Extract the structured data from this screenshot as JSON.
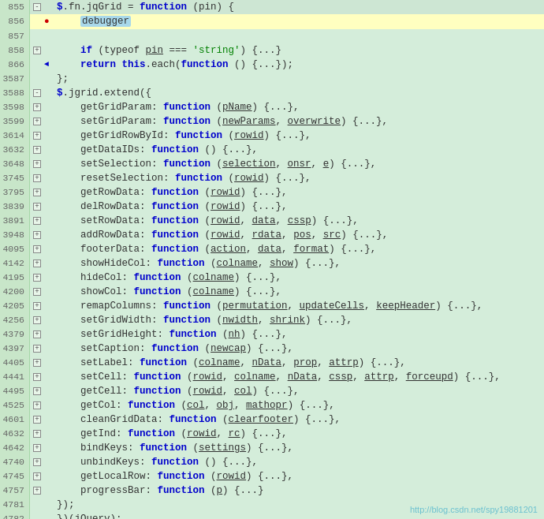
{
  "watermark": "http://blog.csdn.net/spy19881201",
  "lines": [
    {
      "num": "855",
      "indent": 0,
      "fold": "-",
      "arrow": "",
      "breakpoint": false,
      "content": "<span class='kw'>$</span>.fn.jqGrid = <span class='kw'>function</span> (pin) {",
      "highlight": false
    },
    {
      "num": "856",
      "indent": 1,
      "fold": "",
      "arrow": "●",
      "breakpoint": true,
      "content": "<span class='debugger-highlight'>debugger</span>",
      "highlight": true
    },
    {
      "num": "857",
      "indent": 0,
      "fold": "",
      "arrow": "",
      "breakpoint": false,
      "content": "",
      "highlight": false
    },
    {
      "num": "858",
      "indent": 1,
      "fold": "+",
      "arrow": "",
      "breakpoint": false,
      "content": "<span class='kw'>if</span> (typeof <span class='param'>pin</span> === <span class='string'>'string'</span>) {...}",
      "highlight": false
    },
    {
      "num": "866",
      "indent": 1,
      "fold": "",
      "arrow": "◄",
      "breakpoint": false,
      "content": "<span class='kw'>return</span> <span class='kw'>this</span>.each(<span class='kw'>function</span> () {...});",
      "highlight": false
    },
    {
      "num": "3587",
      "indent": 0,
      "fold": "",
      "arrow": "",
      "breakpoint": false,
      "content": "};",
      "highlight": false
    },
    {
      "num": "3588",
      "indent": 0,
      "fold": "-",
      "arrow": "",
      "breakpoint": false,
      "content": "<span class='kw'>$</span>.jgrid.extend({",
      "highlight": false
    },
    {
      "num": "3598",
      "indent": 1,
      "fold": "+",
      "arrow": "",
      "breakpoint": false,
      "content": "getGridParam: <span class='kw'>function</span> (<span class='param'>pName</span>) {...},",
      "highlight": false
    },
    {
      "num": "3599",
      "indent": 1,
      "fold": "+",
      "arrow": "",
      "breakpoint": false,
      "content": "setGridParam: <span class='kw'>function</span> (<span class='param'>newParams</span>, <span class='param'>overwrite</span>) {...},",
      "highlight": false
    },
    {
      "num": "3614",
      "indent": 1,
      "fold": "+",
      "arrow": "",
      "breakpoint": false,
      "content": "getGridRowById: <span class='kw'>function</span> (<span class='param'>rowid</span>) {...},",
      "highlight": false
    },
    {
      "num": "3632",
      "indent": 1,
      "fold": "+",
      "arrow": "",
      "breakpoint": false,
      "content": "getDataIDs: <span class='kw'>function</span> () {...},",
      "highlight": false
    },
    {
      "num": "3648",
      "indent": 1,
      "fold": "+",
      "arrow": "",
      "breakpoint": false,
      "content": "setSelection: <span class='kw'>function</span> (<span class='param'>selection</span>, <span class='param'>onsr</span>, <span class='param'>e</span>) {...},",
      "highlight": false
    },
    {
      "num": "3745",
      "indent": 1,
      "fold": "+",
      "arrow": "",
      "breakpoint": false,
      "content": "resetSelection: <span class='kw'>function</span> (<span class='param'>rowid</span>) {...},",
      "highlight": false
    },
    {
      "num": "3795",
      "indent": 1,
      "fold": "+",
      "arrow": "",
      "breakpoint": false,
      "content": "getRowData: <span class='kw'>function</span> (<span class='param'>rowid</span>) {...},",
      "highlight": false
    },
    {
      "num": "3839",
      "indent": 1,
      "fold": "+",
      "arrow": "",
      "breakpoint": false,
      "content": "delRowData: <span class='kw'>function</span> (<span class='param'>rowid</span>) {...},",
      "highlight": false
    },
    {
      "num": "3891",
      "indent": 1,
      "fold": "+",
      "arrow": "",
      "breakpoint": false,
      "content": "setRowData: <span class='kw'>function</span> (<span class='param'>rowid</span>, <span class='param'>data</span>, <span class='param'>cssp</span>) {...},",
      "highlight": false
    },
    {
      "num": "3948",
      "indent": 1,
      "fold": "+",
      "arrow": "",
      "breakpoint": false,
      "content": "addRowData: <span class='kw'>function</span> (<span class='param'>rowid</span>, <span class='param'>rdata</span>, <span class='param'>pos</span>, <span class='param'>src</span>) {...},",
      "highlight": false
    },
    {
      "num": "4095",
      "indent": 1,
      "fold": "+",
      "arrow": "",
      "breakpoint": false,
      "content": "footerData: <span class='kw'>function</span> (<span class='param'>action</span>, <span class='param'>data</span>, <span class='param'>format</span>) {...},",
      "highlight": false
    },
    {
      "num": "4142",
      "indent": 1,
      "fold": "+",
      "arrow": "",
      "breakpoint": false,
      "content": "showHideCol: <span class='kw'>function</span> (<span class='param'>colname</span>, <span class='param'>show</span>) {...},",
      "highlight": false
    },
    {
      "num": "4195",
      "indent": 1,
      "fold": "+",
      "arrow": "",
      "breakpoint": false,
      "content": "hideCol: <span class='kw'>function</span> (<span class='param'>colname</span>) {...},",
      "highlight": false
    },
    {
      "num": "4200",
      "indent": 1,
      "fold": "+",
      "arrow": "",
      "breakpoint": false,
      "content": "showCol: <span class='kw'>function</span> (<span class='param'>colname</span>) {...},",
      "highlight": false
    },
    {
      "num": "4205",
      "indent": 1,
      "fold": "+",
      "arrow": "",
      "breakpoint": false,
      "content": "remapColumns: <span class='kw'>function</span> (<span class='param'>permutation</span>, <span class='param'>updateCells</span>, <span class='param'>keepHeader</span>) {...},",
      "highlight": false
    },
    {
      "num": "4256",
      "indent": 1,
      "fold": "+",
      "arrow": "",
      "breakpoint": false,
      "content": "setGridWidth: <span class='kw'>function</span> (<span class='param'>nwidth</span>, <span class='param'>shrink</span>) {...},",
      "highlight": false
    },
    {
      "num": "4379",
      "indent": 1,
      "fold": "+",
      "arrow": "",
      "breakpoint": false,
      "content": "setGridHeight: <span class='kw'>function</span> (<span class='param'>nh</span>) {...},",
      "highlight": false
    },
    {
      "num": "4397",
      "indent": 1,
      "fold": "+",
      "arrow": "",
      "breakpoint": false,
      "content": "setCaption: <span class='kw'>function</span> (<span class='param'>newcap</span>) {...},",
      "highlight": false
    },
    {
      "num": "4405",
      "indent": 1,
      "fold": "+",
      "arrow": "",
      "breakpoint": false,
      "content": "setLabel: <span class='kw'>function</span> (<span class='param'>colname</span>, <span class='param'>nData</span>, <span class='param'>prop</span>, <span class='param'>attrp</span>) {...},",
      "highlight": false
    },
    {
      "num": "4441",
      "indent": 1,
      "fold": "+",
      "arrow": "",
      "breakpoint": false,
      "content": "setCell: <span class='kw'>function</span> (<span class='param'>rowid</span>, <span class='param'>colname</span>, <span class='param'>nData</span>, <span class='param'>cssp</span>, <span class='param'>attrp</span>, <span class='param'>forceupd</span>) {...},",
      "highlight": false
    },
    {
      "num": "4495",
      "indent": 1,
      "fold": "+",
      "arrow": "",
      "breakpoint": false,
      "content": "getCell: <span class='kw'>function</span> (<span class='param'>rowid</span>, <span class='param'>col</span>) {...},",
      "highlight": false
    },
    {
      "num": "4525",
      "indent": 1,
      "fold": "+",
      "arrow": "",
      "breakpoint": false,
      "content": "getCol: <span class='kw'>function</span> (<span class='param'>col</span>, <span class='param'>obj</span>, <span class='param'>mathopr</span>) {...},",
      "highlight": false
    },
    {
      "num": "4601",
      "indent": 1,
      "fold": "+",
      "arrow": "",
      "breakpoint": false,
      "content": "cleanGridData: <span class='kw'>function</span> (<span class='param'>clearfooter</span>) {...},",
      "highlight": false
    },
    {
      "num": "4632",
      "indent": 1,
      "fold": "+",
      "arrow": "",
      "breakpoint": false,
      "content": "getInd: <span class='kw'>function</span> (<span class='param'>rowid</span>, <span class='param'>rc</span>) {...},",
      "highlight": false
    },
    {
      "num": "4642",
      "indent": 1,
      "fold": "+",
      "arrow": "",
      "breakpoint": false,
      "content": "bindKeys: <span class='kw'>function</span> (<span class='param'>settings</span>) {...},",
      "highlight": false
    },
    {
      "num": "4740",
      "indent": 1,
      "fold": "+",
      "arrow": "",
      "breakpoint": false,
      "content": "unbindKeys: <span class='kw'>function</span> () {...},",
      "highlight": false
    },
    {
      "num": "4745",
      "indent": 1,
      "fold": "+",
      "arrow": "",
      "breakpoint": false,
      "content": "getLocalRow: <span class='kw'>function</span> (<span class='param'>rowid</span>) {...},",
      "highlight": false
    },
    {
      "num": "4757",
      "indent": 1,
      "fold": "+",
      "arrow": "",
      "breakpoint": false,
      "content": "progressBar: <span class='kw'>function</span> (<span class='param'>p</span>) {...}",
      "highlight": false
    },
    {
      "num": "4781",
      "indent": 0,
      "fold": "",
      "arrow": "",
      "breakpoint": false,
      "content": "});",
      "highlight": false
    },
    {
      "num": "4782",
      "indent": 0,
      "fold": "",
      "arrow": "",
      "breakpoint": false,
      "content": "})(jQuery);",
      "highlight": false
    }
  ]
}
